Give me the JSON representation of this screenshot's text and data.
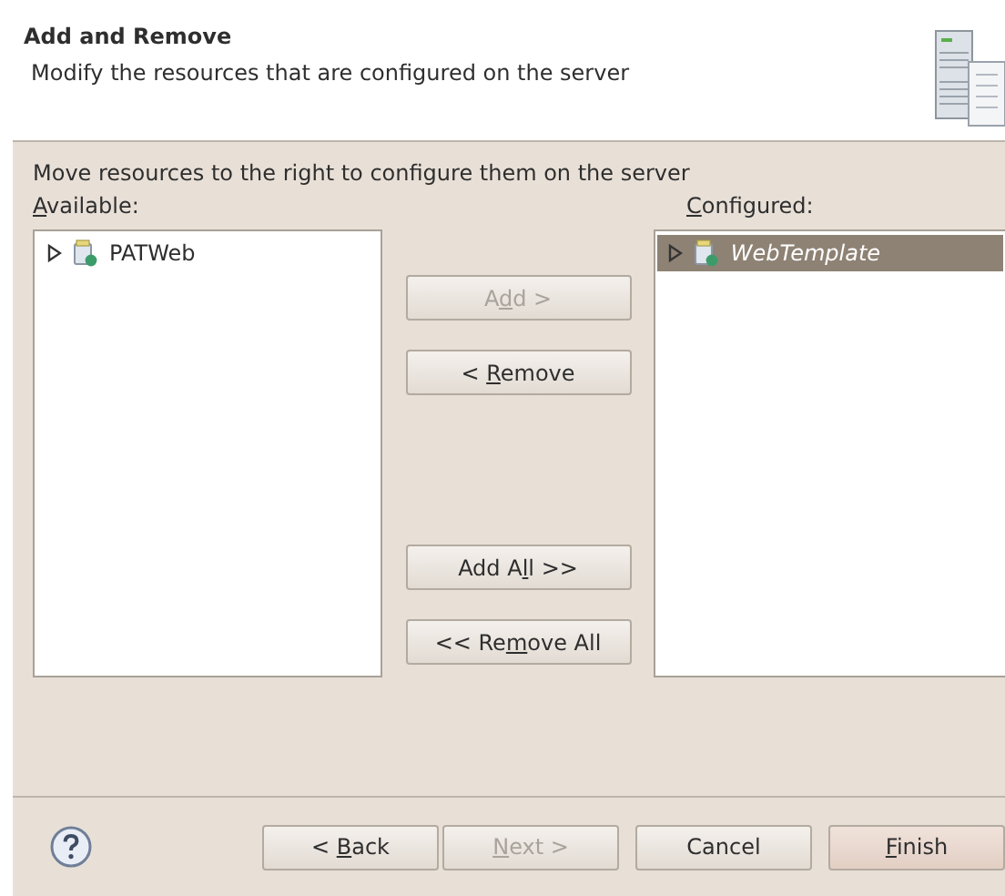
{
  "header": {
    "title": "Add and Remove",
    "description": "Modify the resources that are configured on the server"
  },
  "instruction": "Move resources to the right to configure them on the server",
  "available": {
    "label": {
      "key": "A",
      "after": "vailable:"
    },
    "items": [
      {
        "label": "PATWeb",
        "selected": false,
        "expanded": false
      }
    ]
  },
  "configured": {
    "label": {
      "key": "C",
      "after": "onfigured:"
    },
    "items": [
      {
        "label": "WebTemplate",
        "selected": true,
        "expanded": false
      }
    ]
  },
  "move_buttons": [
    {
      "label": {
        "before": "A",
        "key": "d",
        "after": "d >"
      },
      "disabled": true
    },
    {
      "label": {
        "before": "< ",
        "key": "R",
        "after": "emove"
      },
      "disabled": false
    },
    {
      "label": {
        "before": "Add A",
        "key": "l",
        "after": "l >>"
      },
      "disabled": false
    },
    {
      "label": {
        "before": "<< Re",
        "key": "m",
        "after": "ove All"
      },
      "disabled": false
    }
  ],
  "footer_buttons": [
    {
      "label": {
        "before": "< ",
        "key": "B",
        "after": "ack"
      },
      "disabled": false,
      "default": false
    },
    {
      "label": {
        "key": "N",
        "after": "ext >"
      },
      "disabled": true,
      "default": false
    },
    {
      "label": {
        "before": "Cancel"
      },
      "disabled": false,
      "default": false
    },
    {
      "label": {
        "key": "F",
        "after": "inish"
      },
      "disabled": false,
      "default": true
    }
  ]
}
